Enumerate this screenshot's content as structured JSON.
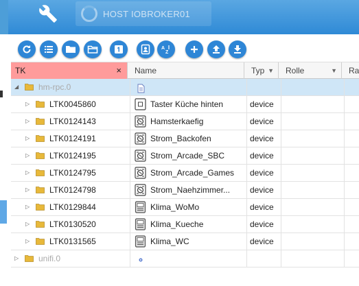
{
  "header": {
    "host_label": "HOST IOBROKER01",
    "wrench_icon": "wrench-icon"
  },
  "toolbar": {
    "buttons": [
      {
        "name": "refresh-button",
        "icon": "refresh-icon"
      },
      {
        "name": "list-view-button",
        "icon": "list-icon"
      },
      {
        "name": "folder-closed-button",
        "icon": "folder-icon"
      },
      {
        "name": "folder-open-button",
        "icon": "folder-open-icon"
      },
      {
        "name": "one-button",
        "icon": "digit-one-icon"
      },
      {
        "name": "contact-button",
        "icon": "contact-card-icon"
      },
      {
        "name": "sort-az-button",
        "icon": "sort-az-icon"
      },
      {
        "name": "add-button",
        "icon": "plus-icon"
      },
      {
        "name": "upload-button",
        "icon": "upload-icon"
      },
      {
        "name": "download-button",
        "icon": "download-icon"
      }
    ]
  },
  "columns": {
    "tk": "TK",
    "tk_clear": "×",
    "name": "Name",
    "typ": "Typ",
    "rolle": "Rolle",
    "ra": "Ra"
  },
  "rows": [
    {
      "id": "hm-rpc.0",
      "name": "",
      "typ": "",
      "level": 0,
      "expanded": true,
      "selected": true,
      "dim": true,
      "icon": "adapter-icon"
    },
    {
      "id": "LTK0045860",
      "name": "Taster Küche hinten",
      "typ": "device",
      "level": 1,
      "icon": "push-button-icon"
    },
    {
      "id": "LTK0124143",
      "name": "Hamsterkaefig",
      "typ": "device",
      "level": 1,
      "icon": "switch-actuator-icon"
    },
    {
      "id": "LTK0124191",
      "name": "Strom_Backofen",
      "typ": "device",
      "level": 1,
      "icon": "switch-actuator-icon"
    },
    {
      "id": "LTK0124195",
      "name": "Strom_Arcade_SBC",
      "typ": "device",
      "level": 1,
      "icon": "switch-actuator-icon"
    },
    {
      "id": "LTK0124795",
      "name": "Strom_Arcade_Games",
      "typ": "device",
      "level": 1,
      "icon": "switch-actuator-icon"
    },
    {
      "id": "LTK0124798",
      "name": "Strom_Naehzimmer...",
      "typ": "device",
      "level": 1,
      "icon": "switch-actuator-icon"
    },
    {
      "id": "LTK0129844",
      "name": "Klima_WoMo",
      "typ": "device",
      "level": 1,
      "icon": "climate-sensor-icon"
    },
    {
      "id": "LTK0130520",
      "name": "Klima_Kueche",
      "typ": "device",
      "level": 1,
      "icon": "climate-sensor-icon"
    },
    {
      "id": "LTK0131565",
      "name": "Klima_WC",
      "typ": "device",
      "level": 1,
      "icon": "climate-sensor-icon"
    },
    {
      "id": "unifi.0",
      "name": "",
      "typ": "",
      "level": 0,
      "expanded": false,
      "selected": false,
      "dim": true,
      "icon": "unifi-icon"
    }
  ]
}
